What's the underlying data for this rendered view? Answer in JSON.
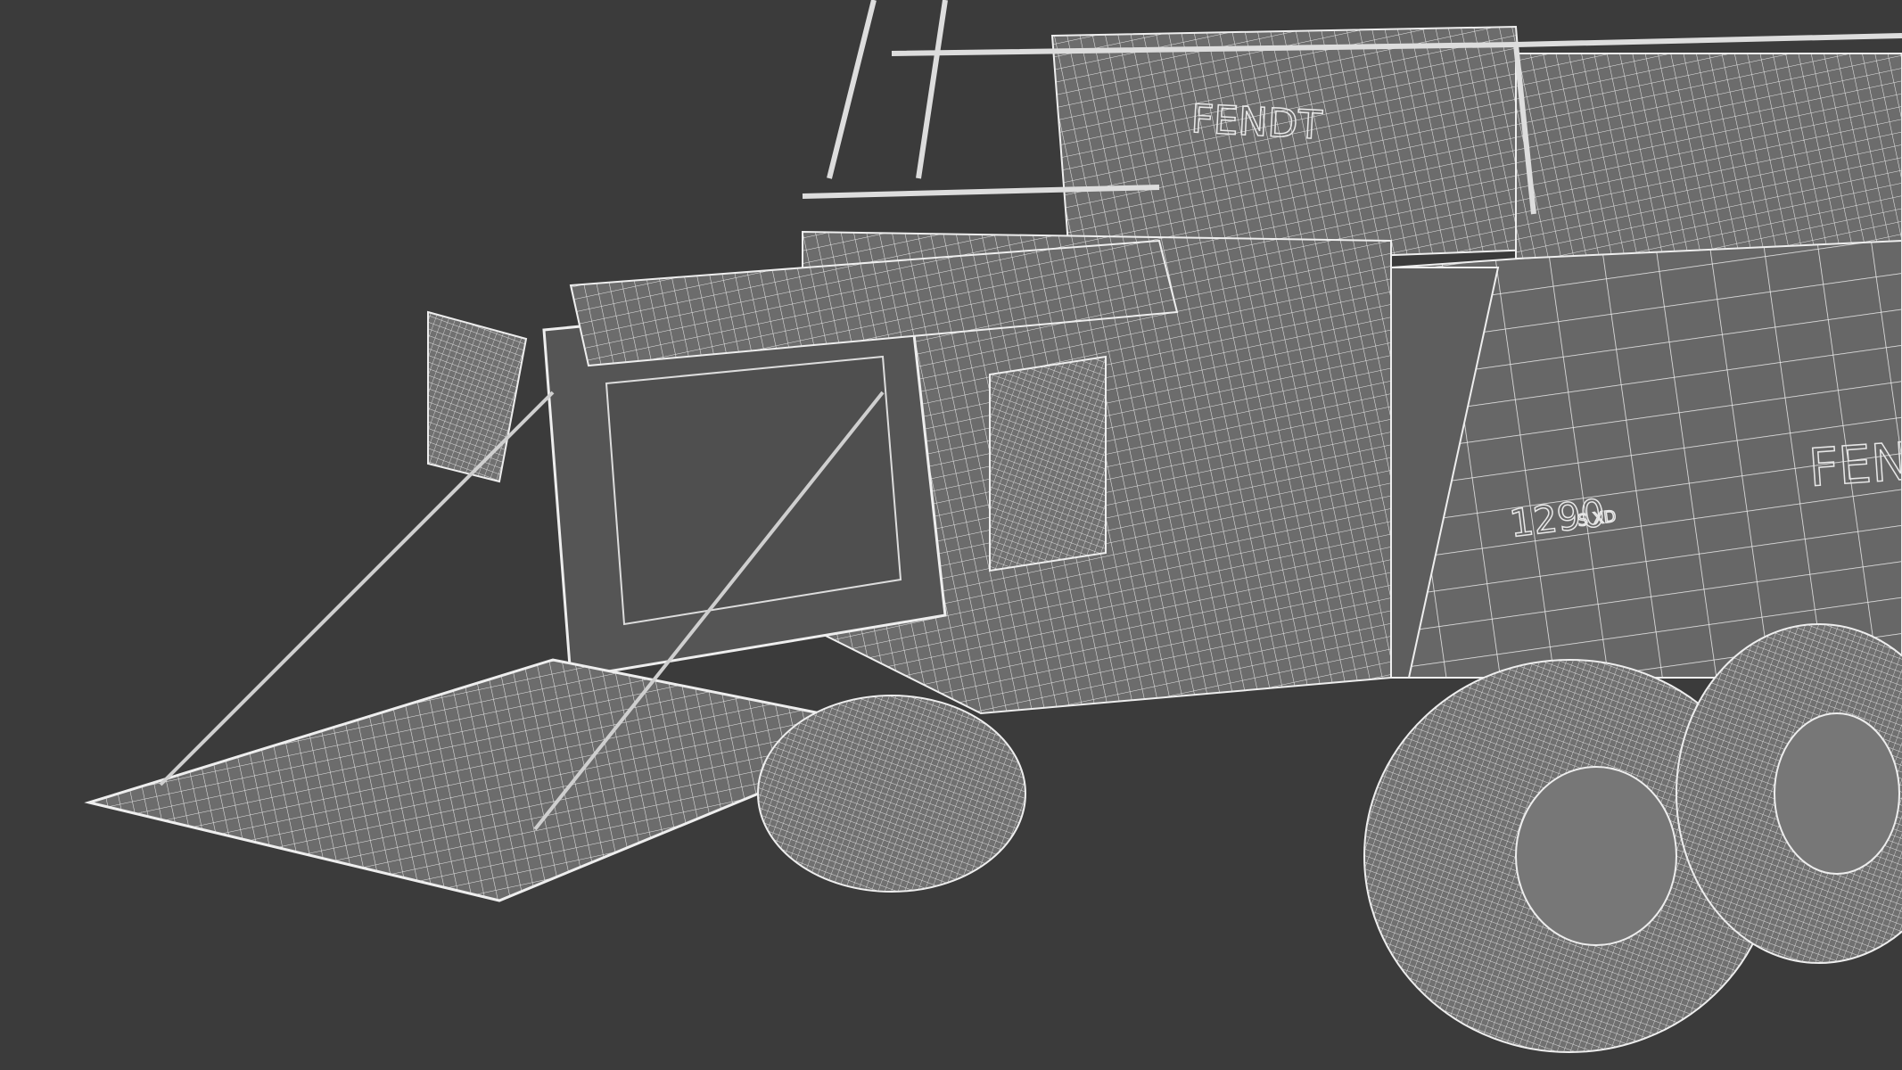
{
  "scene": {
    "subject": "Fendt large square baler wireframe render",
    "background_color": "#3b3b3b",
    "mesh_color": "#6c6c6c",
    "wire_color": "#f0f0f0"
  },
  "labels": {
    "top_brand": "FENDT",
    "side_brand": "FEND",
    "model_number": "1290",
    "model_suffix": "S XD"
  }
}
